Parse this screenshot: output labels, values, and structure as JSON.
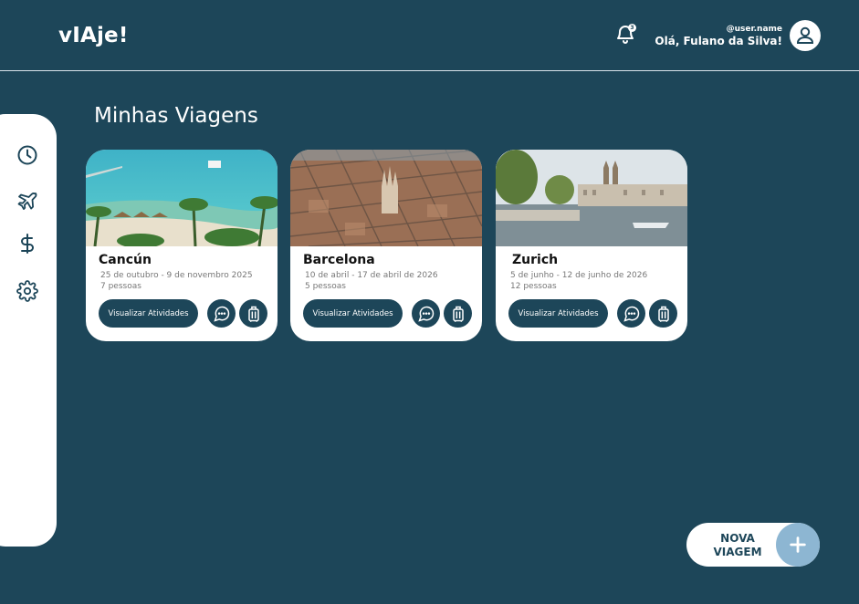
{
  "header": {
    "logo": "vIAje!",
    "notification_count": "3",
    "username": "@user.name",
    "greeting": "Olá, Fulano da Silva!"
  },
  "sidebar": {
    "items": [
      {
        "icon": "clock-icon"
      },
      {
        "icon": "airplane-icon"
      },
      {
        "icon": "dollar-icon"
      },
      {
        "icon": "gear-icon"
      }
    ]
  },
  "main": {
    "title": "Minhas Viagens",
    "trips": [
      {
        "city": "Cancún",
        "dates": "25 de outubro - 9 de novembro 2025",
        "people": "7 pessoas",
        "button": "Visualizar Atividades"
      },
      {
        "city": "Barcelona",
        "dates": "10 de abril - 17 de abril  de 2026",
        "people": "5 pessoas",
        "button": "Visualizar Atividades"
      },
      {
        "city": "Zurich",
        "dates": "5 de junho  - 12 de junho de 2026",
        "people": "12 pessoas",
        "button": "Visualizar Atividades"
      }
    ]
  },
  "fab": {
    "line1": "NOVA",
    "line2": "VIAGEM"
  },
  "colors": {
    "background": "#1d4659",
    "accent": "#8db6d2",
    "surface": "#ffffff"
  }
}
